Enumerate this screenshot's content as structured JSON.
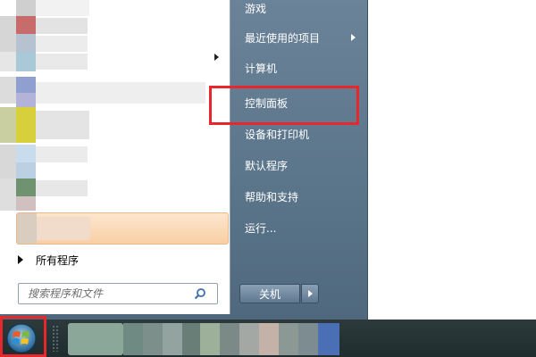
{
  "start_menu": {
    "right_items": [
      {
        "label": "游戏",
        "has_submenu": false
      },
      {
        "label": "最近使用的项目",
        "has_submenu": true
      },
      {
        "label": "计算机",
        "has_submenu": false
      },
      {
        "label": "控制面板",
        "has_submenu": false,
        "highlighted": true
      },
      {
        "label": "设备和打印机",
        "has_submenu": false
      },
      {
        "label": "默认程序",
        "has_submenu": false
      },
      {
        "label": "帮助和支持",
        "has_submenu": false
      },
      {
        "label": "运行...",
        "has_submenu": false
      }
    ],
    "all_programs_label": "所有程序",
    "search_placeholder": "搜索程序和文件",
    "shutdown_label": "关机"
  },
  "colors": {
    "annotation_red": "#e8272d",
    "menu_right_pane": "#5a7489",
    "highlight_orange": "#f9cfa4"
  },
  "icons": {
    "search": "search-icon",
    "windows_orb": "windows-start-orb-icon"
  }
}
